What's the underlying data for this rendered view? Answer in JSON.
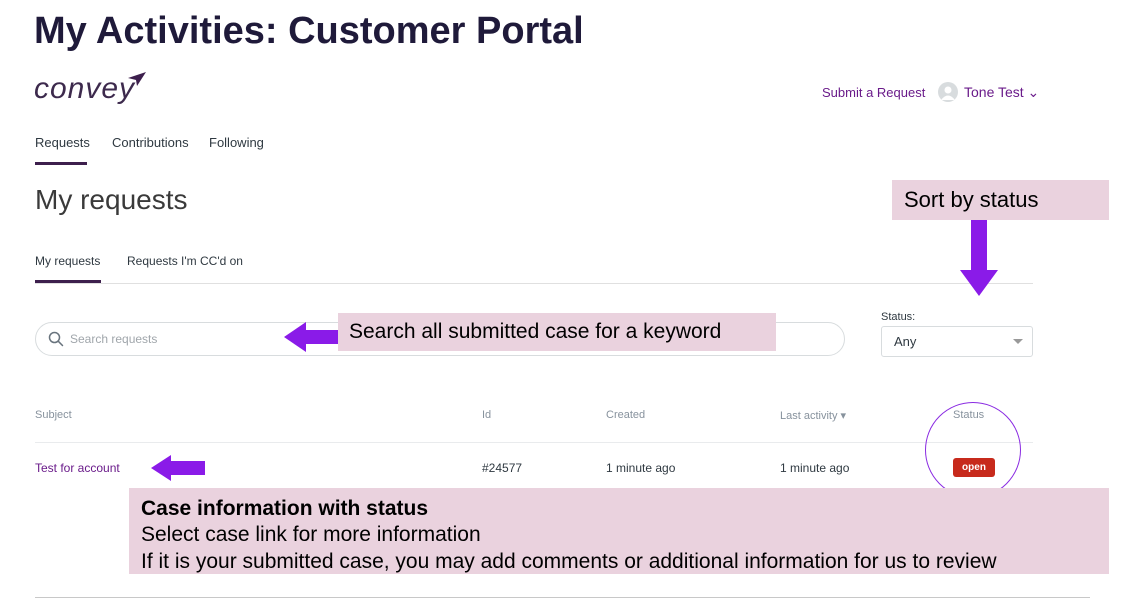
{
  "slide": {
    "title": "My Activities: Customer Portal"
  },
  "header": {
    "logo": "convey",
    "submit_link": "Submit a Request",
    "user_name": "Tone Test ⌄"
  },
  "nav": {
    "tabs": [
      {
        "label": "Requests"
      },
      {
        "label": "Contributions"
      },
      {
        "label": "Following"
      }
    ]
  },
  "page": {
    "heading": "My requests"
  },
  "subtabs": [
    {
      "label": "My requests"
    },
    {
      "label": "Requests I'm CC'd on"
    }
  ],
  "search": {
    "placeholder": "Search requests",
    "value": ""
  },
  "filter": {
    "label": "Status:",
    "selected": "Any"
  },
  "table": {
    "headers": {
      "subject": "Subject",
      "id": "Id",
      "created": "Created",
      "last_activity": "Last activity ▾",
      "status": "Status"
    },
    "rows": [
      {
        "subject": "Test for account",
        "id": "#24577",
        "created": "1 minute ago",
        "last_activity": "1 minute ago",
        "status": "open"
      }
    ]
  },
  "annotations": {
    "sort": "Sort by status",
    "search": "Search all submitted case for a keyword",
    "case_title": "Case information with status",
    "case_line2": "Select case link for more information",
    "case_line3": "If it is your submitted case, you may add comments or additional information for us to review"
  },
  "colors": {
    "accent": "#6a1b8a",
    "arrow": "#8a1be8",
    "badge": "#c72a1c",
    "callout_bg": "#ead2de",
    "title": "#1f1a3a"
  },
  "icons": {
    "search": "search-icon",
    "avatar": "user-avatar-icon",
    "dropdown": "chevron-down-icon",
    "logo_mark": "paper-plane-icon"
  }
}
